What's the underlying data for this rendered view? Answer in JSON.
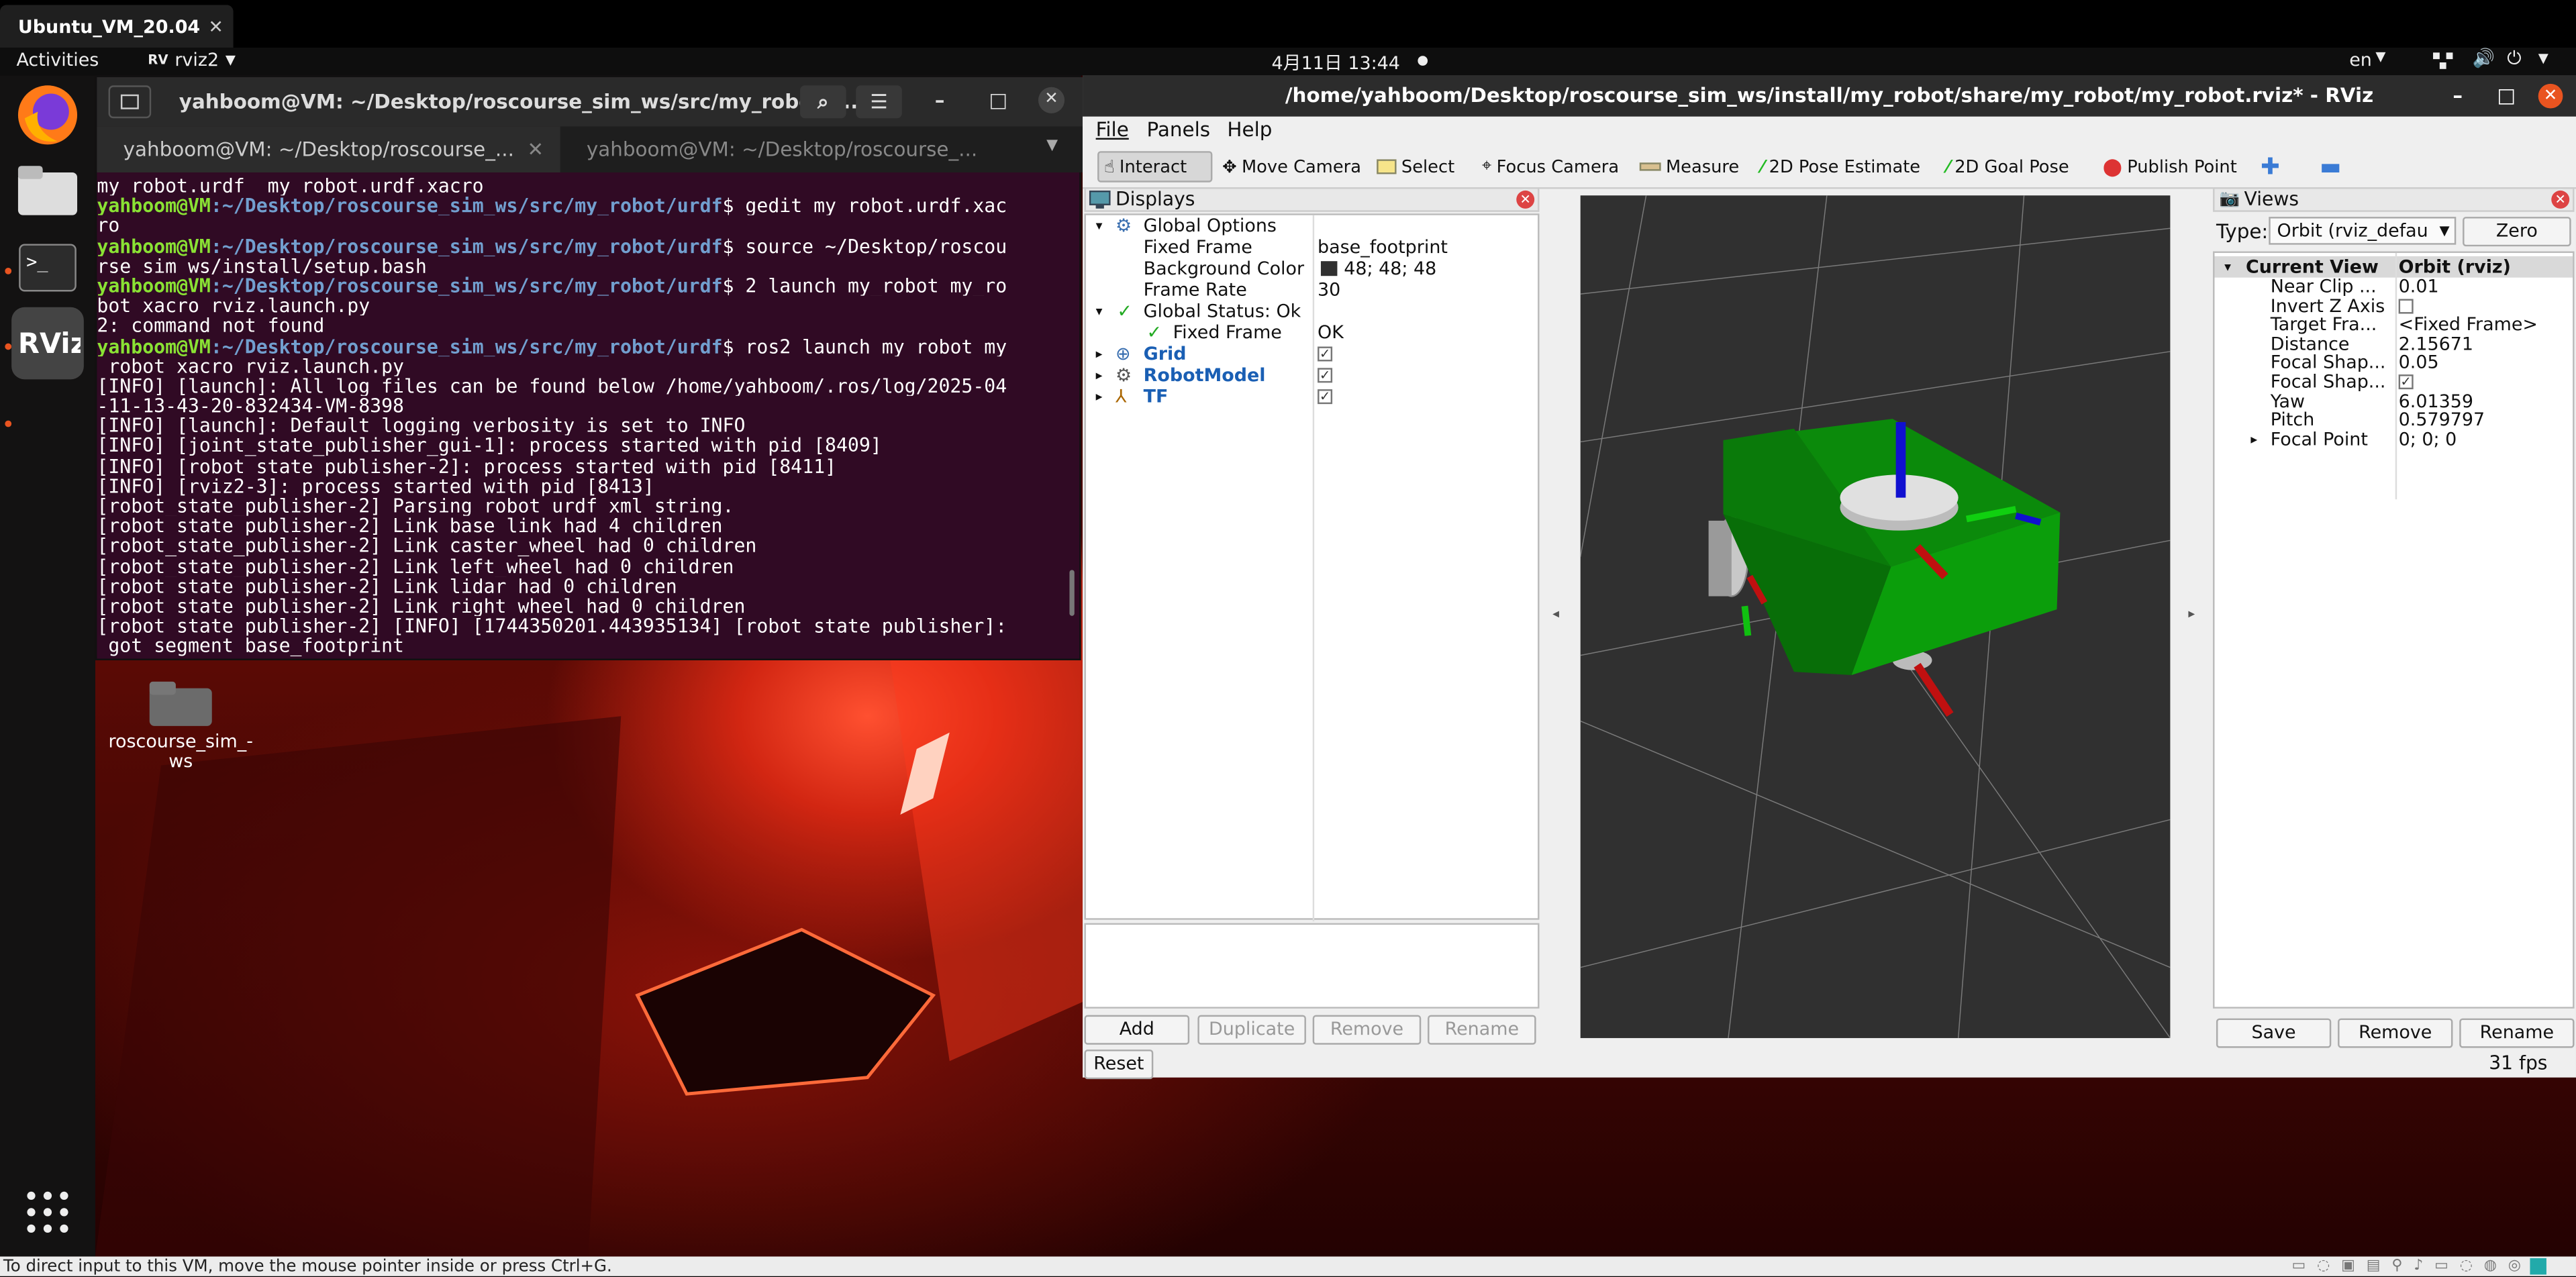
{
  "vm": {
    "tab_title": "Ubuntu_VM_20.04",
    "tab_close": "✕",
    "status_message": "To direct input to this VM, move the mouse pointer inside or press Ctrl+G."
  },
  "topbar": {
    "activities": "Activities",
    "app": "rviz2",
    "datetime": "4月11日  13:44",
    "lang": "en"
  },
  "desktop": {
    "folder_label": "roscourse_sim_-ws"
  },
  "terminal": {
    "title": "yahboom@VM: ~/Desktop/roscourse_sim_ws/src/my_robot/u...",
    "tab1": "yahboom@VM: ~/Desktop/roscourse_...",
    "tab2": "yahboom@VM: ~/Desktop/roscourse_...",
    "lines": [
      {
        "text": "my_robot.urdf  my_robot.urdf.xacro"
      },
      {
        "user": "yahboom@VM",
        "path": ":~/Desktop/roscourse_sim_ws/src/my_robot/urdf",
        "cmd": "$ gedit my_robot.urdf.xac"
      },
      {
        "text": "ro"
      },
      {
        "user": "yahboom@VM",
        "path": ":~/Desktop/roscourse_sim_ws/src/my_robot/urdf",
        "cmd": "$ source ~/Desktop/roscou"
      },
      {
        "text": "rse_sim_ws/install/setup.bash"
      },
      {
        "user": "yahboom@VM",
        "path": ":~/Desktop/roscourse_sim_ws/src/my_robot/urdf",
        "cmd": "$ 2 launch my_robot my_ro"
      },
      {
        "text": "bot_xacro_rviz.launch.py"
      },
      {
        "text": "2: command not found"
      },
      {
        "user": "yahboom@VM",
        "path": ":~/Desktop/roscourse_sim_ws/src/my_robot/urdf",
        "cmd": "$ ros2 launch my_robot my"
      },
      {
        "text": "_robot_xacro_rviz.launch.py"
      },
      {
        "text": "[INFO] [launch]: All log files can be found below /home/yahboom/.ros/log/2025-04"
      },
      {
        "text": "-11-13-43-20-832434-VM-8398"
      },
      {
        "text": "[INFO] [launch]: Default logging verbosity is set to INFO"
      },
      {
        "text": "[INFO] [joint_state_publisher_gui-1]: process started with pid [8409]"
      },
      {
        "text": "[INFO] [robot_state_publisher-2]: process started with pid [8411]"
      },
      {
        "text": "[INFO] [rviz2-3]: process started with pid [8413]"
      },
      {
        "text": "[robot_state_publisher-2] Parsing robot urdf xml string."
      },
      {
        "text": "[robot_state_publisher-2] Link base_link had 4 children"
      },
      {
        "text": "[robot_state_publisher-2] Link caster_wheel had 0 children"
      },
      {
        "text": "[robot_state_publisher-2] Link left_wheel had 0 children"
      },
      {
        "text": "[robot_state_publisher-2] Link lidar had 0 children"
      },
      {
        "text": "[robot_state_publisher-2] Link right_wheel had 0 children"
      },
      {
        "text": "[robot_state_publisher-2] [INFO] [1744350201.443935134] [robot_state_publisher]:"
      },
      {
        "text": " got segment base_footprint"
      }
    ]
  },
  "rviz": {
    "title": "/home/yahboom/Desktop/roscourse_sim_ws/install/my_robot/share/my_robot/my_robot.rviz* - RViz",
    "menu": [
      "File",
      "Panels",
      "Help"
    ],
    "tools": [
      "Interact",
      "Move Camera",
      "Select",
      "Focus Camera",
      "Measure",
      "2D Pose Estimate",
      "2D Goal Pose",
      "Publish Point"
    ],
    "displays": {
      "header": "Displays",
      "global_options": "Global Options",
      "fixed_frame_label": "Fixed Frame",
      "fixed_frame_value": "base_footprint",
      "bg_label": "Background Color",
      "bg_value": "48; 48; 48",
      "fr_label": "Frame Rate",
      "fr_value": "30",
      "global_status": "Global Status: Ok",
      "status_ff_label": "Fixed Frame",
      "status_ff_value": "OK",
      "items": [
        "Grid",
        "RobotModel",
        "TF"
      ]
    },
    "buttons": {
      "add": "Add",
      "duplicate": "Duplicate",
      "remove": "Remove",
      "rename": "Rename",
      "reset": "Reset"
    },
    "views": {
      "header": "Views",
      "type_label": "Type:",
      "type_value": "Orbit (rviz_defau",
      "zero": "Zero",
      "current_view": "Current View",
      "current_view_value": "Orbit (rviz)",
      "props": [
        {
          "k": "Near Clip ...",
          "v": "0.01"
        },
        {
          "k": "Invert Z Axis",
          "v": ""
        },
        {
          "k": "Target Fra...",
          "v": "<Fixed Frame>"
        },
        {
          "k": "Distance",
          "v": "2.15671"
        },
        {
          "k": "Focal Shap...",
          "v": "0.05"
        },
        {
          "k": "Focal Shap...",
          "v": ""
        },
        {
          "k": "Yaw",
          "v": "6.01359"
        },
        {
          "k": "Pitch",
          "v": "0.579797"
        },
        {
          "k": "Focal Point",
          "v": "0; 0; 0"
        }
      ],
      "save": "Save",
      "remove": "Remove",
      "rename": "Rename"
    },
    "fps": "31 fps"
  },
  "colors": {
    "terminal_bg": "#300a24",
    "rviz_bg": "#303030",
    "prompt_green": "#8ae234",
    "prompt_blue": "#729fcf"
  }
}
